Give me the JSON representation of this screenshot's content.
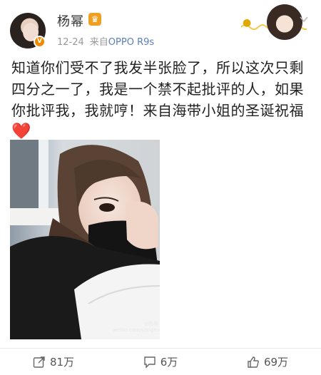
{
  "post": {
    "username": "杨幂",
    "time": "12-24",
    "source_prefix": "来自",
    "device": "OPPO R9s",
    "text_line1": "知道你们受不了我发半张脸了，所以这次只剩",
    "text_line2": "四分之一了，我是一个禁不起批评的人，如果",
    "text_line3": "你批评我，我就哼！来自海带小姐的圣诞祝福",
    "heart": "❤️",
    "watermark_line1": "◎杨幂",
    "watermark_line2": "weibo.com/yangmiblog"
  },
  "actions": {
    "repost_count": "81万",
    "comment_count": "6万",
    "like_count": "69万"
  },
  "icons": {
    "vip": "crown-icon",
    "verified": "verified-badge-icon",
    "menu": "chevron-down-icon",
    "repost": "repost-icon",
    "comment": "comment-icon",
    "like": "thumbs-up-icon"
  },
  "colors": {
    "device_link": "#5b7fb7",
    "verified_badge": "#f08a00",
    "heart": "#e0283a"
  }
}
